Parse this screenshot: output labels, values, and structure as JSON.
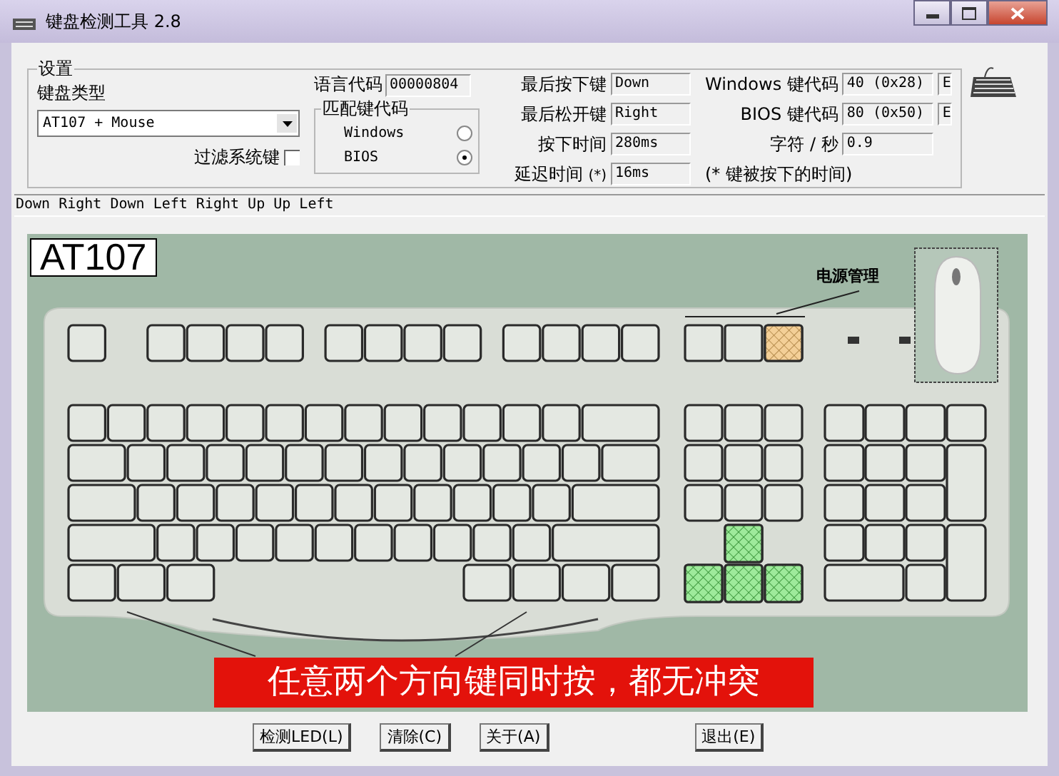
{
  "window": {
    "title": "键盘检测工具 2.8"
  },
  "settings": {
    "title": "设置",
    "keyboard_type": {
      "label": "键盘类型",
      "value": "AT107 + Mouse"
    },
    "filter_system_keys": {
      "label": "过滤系统键",
      "checked": false
    },
    "language_code": {
      "label": "语言代码",
      "value": "00000804"
    },
    "match_code": {
      "title": "匹配键代码",
      "options": [
        {
          "label": "Windows",
          "selected": false
        },
        {
          "label": "BIOS",
          "selected": true
        }
      ]
    },
    "fields": [
      {
        "label": "最后按下键",
        "value": "Down"
      },
      {
        "label": "最后松开键",
        "value": "Right"
      },
      {
        "label": "按下时间",
        "value": "280ms"
      },
      {
        "label": "延迟时间",
        "suffix": "(*)",
        "value": "16ms"
      }
    ],
    "codes": [
      {
        "label": "Windows 键代码",
        "value": "40 (0x28)",
        "flag": "E"
      },
      {
        "label": "BIOS 键代码",
        "value": "80 (0x50)",
        "flag": "E"
      },
      {
        "label": "字符 / 秒",
        "value": "0.9"
      }
    ],
    "note": "(* 键被按下的时间)"
  },
  "key_log": "Down Right Down Left Right Up Up Left",
  "keyboard": {
    "model_label": "AT107",
    "callout": "电源管理",
    "power_keys": [
      {
        "highlighted": false
      },
      {
        "highlighted": false
      },
      {
        "highlighted": true
      }
    ],
    "arrow_keys": [
      {
        "pressed": true
      },
      {
        "pressed": true
      },
      {
        "pressed": true
      },
      {
        "pressed": true
      }
    ]
  },
  "caption": "任意两个方向键同时按，都无冲突",
  "buttons": [
    "检测LED(L)",
    "清除(C)",
    "关于(A)",
    "退出(E)"
  ]
}
